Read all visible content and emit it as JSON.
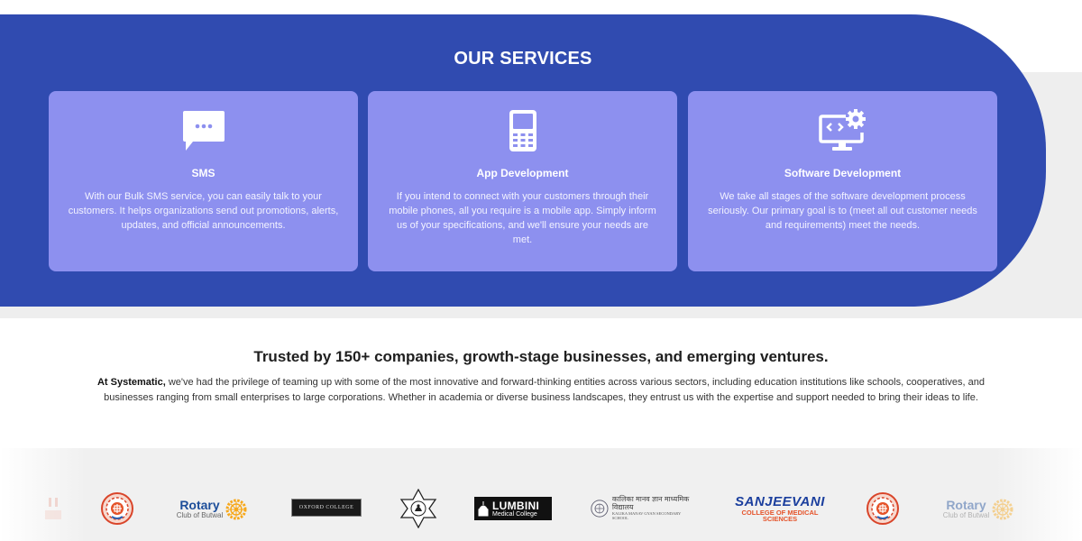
{
  "services": {
    "title": "OUR SERVICES",
    "cards": [
      {
        "icon": "sms-chat-icon",
        "title": "SMS",
        "description": "With our Bulk SMS service, you can easily talk to your customers. It helps organizations send out promotions, alerts, updates, and official announcements."
      },
      {
        "icon": "mobile-phone-icon",
        "title": "App Development",
        "description": "If you intend to connect with your customers through their mobile phones, all you require is a mobile app. Simply inform us of your specifications, and we'll ensure your needs are met."
      },
      {
        "icon": "monitor-gear-icon",
        "title": "Software Development",
        "description": "We take all stages of the software development process seriously. Our primary goal is to (meet all out customer needs and requirements) meet the needs."
      }
    ]
  },
  "trusted": {
    "title": "Trusted by 150+ companies, growth-stage businesses, and emerging ventures.",
    "lead": "At Systematic,",
    "body": " we've had the privilege of teaming up with some of the most innovative and forward-thinking entities across various sectors, including education institutions like schools, cooperatives, and businesses ranging from small enterprises to large corporations. Whether in academia or diverse business landscapes, they entrust us with the expertise and support needed to bring their ideas to life."
  },
  "logos": {
    "rotary_name": "Rotary",
    "rotary_sub": "Club of Butwal",
    "oxford": "OXFORD COLLEGE",
    "lumbini_main": "LUMBINI",
    "lumbini_sub": "Medical College",
    "kalika_np": "कालिका मानव ज्ञान माध्यमिक विद्यालय",
    "kalika_en": "KALIKA MANAV GYAN SECONDARY SCHOOL",
    "sanjeevani_main": "SANJEEVANI",
    "sanjeevani_sub": "COLLEGE OF MEDICAL SCIENCES",
    "colors": {
      "brand_blue": "#304bb0",
      "card": "#8d90ef",
      "rotary_gold": "#f7a81b",
      "sanjeevani_blue": "#1b3f9e",
      "sanjeevani_orange": "#e5532a"
    }
  }
}
